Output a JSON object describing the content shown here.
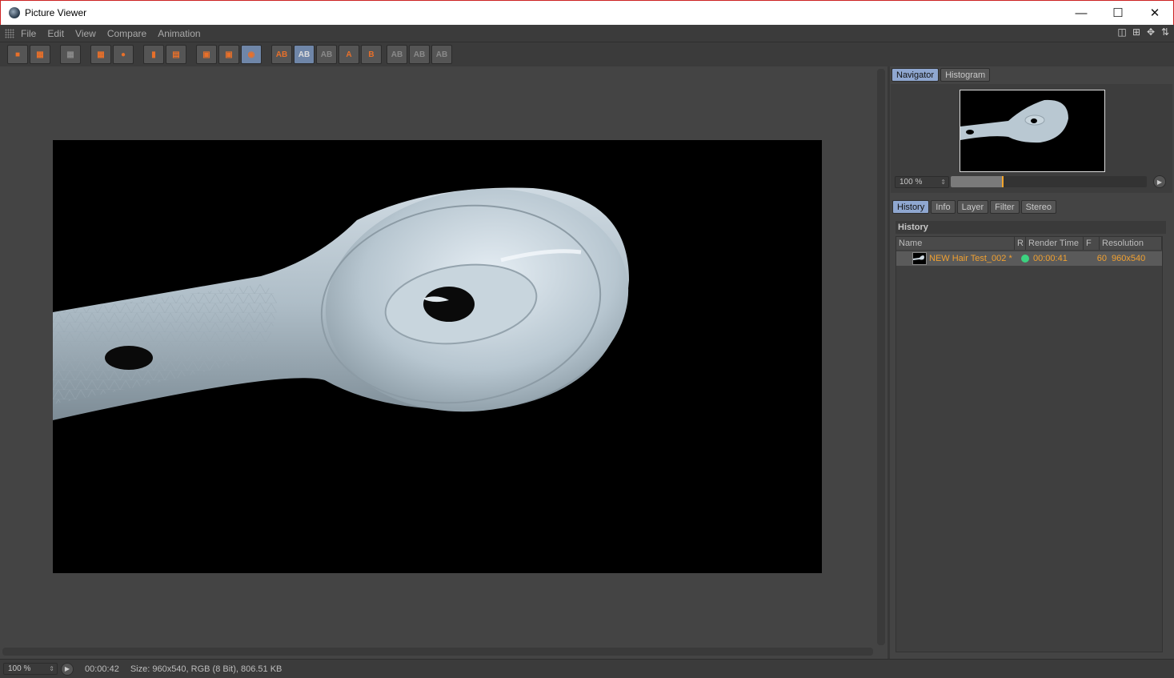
{
  "window": {
    "title": "Picture Viewer"
  },
  "menu": [
    "File",
    "Edit",
    "View",
    "Compare",
    "Animation"
  ],
  "toolbar": {
    "ab_label": "AB",
    "a_label": "A",
    "b_label": "B"
  },
  "navigator": {
    "tabs": [
      "Navigator",
      "Histogram"
    ],
    "zoom": "100 %",
    "zoom_fraction": 0.26
  },
  "history": {
    "tabs": [
      "History",
      "Info",
      "Layer",
      "Filter",
      "Stereo"
    ],
    "section_title": "History",
    "columns": [
      "Name",
      "R",
      "Render Time",
      "F",
      "Resolution"
    ],
    "rows": [
      {
        "name": "NEW Hair Test_002 *",
        "render_time": "00:00:41",
        "frame": "60",
        "resolution": "960x540"
      }
    ]
  },
  "status": {
    "zoom": "100 %",
    "time": "00:00:42",
    "info": "Size: 960x540, RGB (8 Bit), 806.51 KB"
  },
  "colors": {
    "accent": "#f0a030",
    "active_tab": "#8fa7d0",
    "render_status": "#3cd280"
  }
}
